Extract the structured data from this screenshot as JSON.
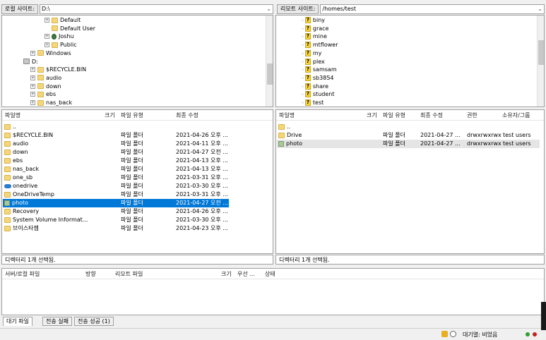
{
  "local": {
    "site_label": "로컬 사이트:",
    "path": "D:\\",
    "tree": [
      {
        "name": "Default",
        "indent": 2,
        "plus": true
      },
      {
        "name": "Default User",
        "indent": 2,
        "plus": false
      },
      {
        "name": "Joshu",
        "indent": 2,
        "plus": true,
        "user": true
      },
      {
        "name": "Public",
        "indent": 2,
        "plus": true
      },
      {
        "name": "Windows",
        "indent": 1,
        "plus": true
      },
      {
        "name": "D:",
        "indent": 0,
        "plus": false,
        "drive": true
      },
      {
        "name": "$RECYCLE.BIN",
        "indent": 1,
        "plus": true
      },
      {
        "name": "audio",
        "indent": 1,
        "plus": true
      },
      {
        "name": "down",
        "indent": 1,
        "plus": true
      },
      {
        "name": "ebs",
        "indent": 1,
        "plus": true
      },
      {
        "name": "nas_back",
        "indent": 1,
        "plus": true
      }
    ],
    "columns": {
      "name": "파일명",
      "size": "크기",
      "type": "파일 유형",
      "modified": "최종 수정"
    },
    "files": [
      {
        "name": "..",
        "type": "",
        "modified": ""
      },
      {
        "name": "$RECYCLE.BIN",
        "type": "파일 폴더",
        "modified": "2021-04-26 오후 ..."
      },
      {
        "name": "audio",
        "type": "파일 폴더",
        "modified": "2021-04-11 오후 ..."
      },
      {
        "name": "down",
        "type": "파일 폴더",
        "modified": "2021-04-27 오전 ..."
      },
      {
        "name": "ebs",
        "type": "파일 폴더",
        "modified": "2021-04-13 오후 ..."
      },
      {
        "name": "nas_back",
        "type": "파일 폴더",
        "modified": "2021-04-13 오후 ..."
      },
      {
        "name": "one_sb",
        "type": "파일 폴더",
        "modified": "2021-03-31 오후 ..."
      },
      {
        "name": "onedrive",
        "type": "파일 폴더",
        "modified": "2021-03-30 오후 ..."
      },
      {
        "name": "OneDriveTemp",
        "type": "파일 폴더",
        "modified": "2021-03-31 오후 ..."
      },
      {
        "name": "photo",
        "type": "파일 폴더",
        "modified": "2021-04-27 오전 ..."
      },
      {
        "name": "Recovery",
        "type": "파일 폴더",
        "modified": "2021-04-26 오후 ..."
      },
      {
        "name": "System Volume Informat...",
        "type": "파일 폴더",
        "modified": "2021-03-30 오후 ..."
      },
      {
        "name": "브이스타젬",
        "type": "파일 폴더",
        "modified": "2021-04-23 오후 ..."
      }
    ],
    "status": "디렉터리 1개 선택됨."
  },
  "remote": {
    "site_label": "리모트 사이트:",
    "path": "/homes/test",
    "tree": [
      {
        "name": "biny"
      },
      {
        "name": "grace"
      },
      {
        "name": "mine"
      },
      {
        "name": "mtflower"
      },
      {
        "name": "my"
      },
      {
        "name": "plex"
      },
      {
        "name": "samsam"
      },
      {
        "name": "sb3854"
      },
      {
        "name": "share"
      },
      {
        "name": "student"
      },
      {
        "name": "test"
      }
    ],
    "columns": {
      "name": "파일명",
      "size": "크기",
      "type": "파일 유형",
      "modified": "최종 수정",
      "perm": "권한",
      "owner": "소유자/그룹"
    },
    "files": [
      {
        "name": "..",
        "type": "",
        "modified": "",
        "perm": "",
        "owner": ""
      },
      {
        "name": "Drive",
        "type": "파일 폴더",
        "modified": "2021-04-27 ...",
        "perm": "drwxrwxrwx",
        "owner": "test users"
      },
      {
        "name": "photo",
        "type": "파일 폴더",
        "modified": "2021-04-27 ...",
        "perm": "drwxrwxrwx",
        "owner": "test users"
      }
    ],
    "status": "디렉터리 1개 선택됨."
  },
  "queue": {
    "columns": {
      "server": "서버/로컬 파일",
      "direction": "방향",
      "remote": "리모트 파일",
      "size": "크기",
      "priority": "우선 ...",
      "state": "상태"
    },
    "tabs": [
      "대기 파일",
      "전송 실패",
      "전송 성공 (1)"
    ]
  },
  "footer": {
    "queue_status": "대기열: 비었음"
  }
}
